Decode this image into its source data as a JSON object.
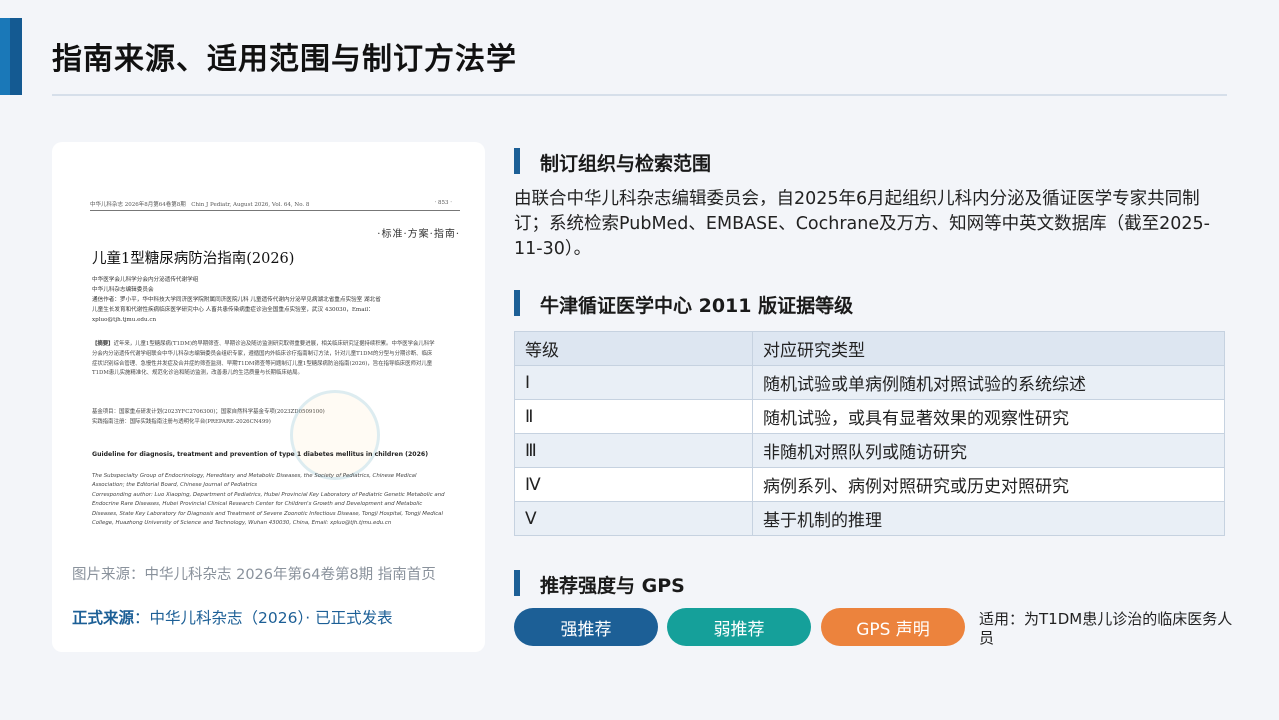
{
  "page": {
    "title": "指南来源、适用范围与制订方法学"
  },
  "document": {
    "header": "中华儿科杂志 2026年8月第64卷第8期　Chin J Pediatr, August 2026, Vol. 64, No. 8",
    "page_no": "· 853 ·",
    "category": "·标准·方案·指南·",
    "title": "儿童1型糖尿病防治指南(2026)",
    "authors": "中华医学会儿科学分会内分泌遗传代谢学组\n中华儿科杂志编辑委员会\n通信作者：罗小平，华中科技大学同济医学院附属同济医院儿科 儿童遗传代谢内分泌罕见病湖北省重点实验室 湖北省儿童生长发育和代谢性疾病临床医学研究中心 人畜共患传染病重症诊治全国重点实验室，武汉 430030，Email：xpluo@tjh.tjmu.edu.cn",
    "abstract_label": "【摘要】",
    "abstract": "近年来，儿童1型糖尿病(T1DM)的早期筛查、早期诊治及随访监测研究取得重要进展，相关临床研究证据持续积累。中华医学会儿科学分会内分泌遗传代谢学组联合中华儿科杂志编辑委员会组织专家，遵循国内外临床诊疗指南制订方法，针对儿童T1DM的分型与分期诊断、临床症状识别综合管理、急慢性并发症及合并症的筛查监测、早期T1DM筛查等问题制订儿童1型糖尿病防治指南(2026)，旨在指导临床医师对儿童T1DM患儿实施精准化、规范化诊治和随访监测，改善患儿的生活质量与长期临床结局。",
    "funding": "基金项目：国家重点研发计划(2023YFC2706300)；国家自然科学基金专项(2023ZD0509100)\n实践指南注册：国际实践指南注册与透明化平台(PREPARE-2026CN499)",
    "en_title": "Guideline for diagnosis, treatment and prevention of type 1 diabetes mellitus in children (2026)",
    "en_authors": "The Subspecialty Group of Endocrinology, Hereditary and Metabolic Diseases, the Society of Pediatrics, Chinese Medical Association; the Editorial Board, Chinese Journal of Pediatrics\nCorresponding author: Luo Xiaoping, Department of Pediatrics, Hubei Provincial Key Laboratory of Pediatric Genetic Metabolic and Endocrine Rare Diseases, Hubei Provincial Clinical Research Center for Children's Growth and Development and Metabolic Diseases, State Key Laboratory for Diagnosis and Treatment of Severe Zoonotic Infectious Disease, Tongji Hospital, Tongji Medical College, Huazhong University of Science and Technology, Wuhan 430030, China, Email: xpluo@tjh.tjmu.edu.cn"
  },
  "captions": {
    "source": "图片来源：中华儿科杂志 2026年第64卷第8期 指南首页",
    "formal_label": "正式来源",
    "formal_text": "：中华儿科杂志（2026）· 已正式发表"
  },
  "section1": {
    "title": "制订组织与检索范围",
    "text": "由联合中华儿科杂志编辑委员会，自2025年6月起组织儿科内分泌及循证医学专家共同制订；系统检索PubMed、EMBASE、Cochrane及万方、知网等中英文数据库（截至2025-11-30）。"
  },
  "section2": {
    "title": "牛津循证医学中心 2011 版证据等级",
    "headers": [
      "等级",
      "对应研究类型"
    ],
    "rows": [
      [
        "Ⅰ",
        "随机试验或单病例随机对照试验的系统综述"
      ],
      [
        "Ⅱ",
        "随机试验，或具有显著效果的观察性研究"
      ],
      [
        "Ⅲ",
        "非随机对照队列或随访研究"
      ],
      [
        "Ⅳ",
        "病例系列、病例对照研究或历史对照研究"
      ],
      [
        "Ⅴ",
        "基于机制的推理"
      ]
    ]
  },
  "section3": {
    "title": "推荐强度与 GPS",
    "pills": [
      {
        "label": "强推荐",
        "color": "#1c5f96"
      },
      {
        "label": "弱推荐",
        "color": "#15a09a"
      },
      {
        "label": "GPS 声明",
        "color": "#ec833d"
      }
    ],
    "applies": "适用：为T1DM患儿诊治的临床医务人员"
  }
}
